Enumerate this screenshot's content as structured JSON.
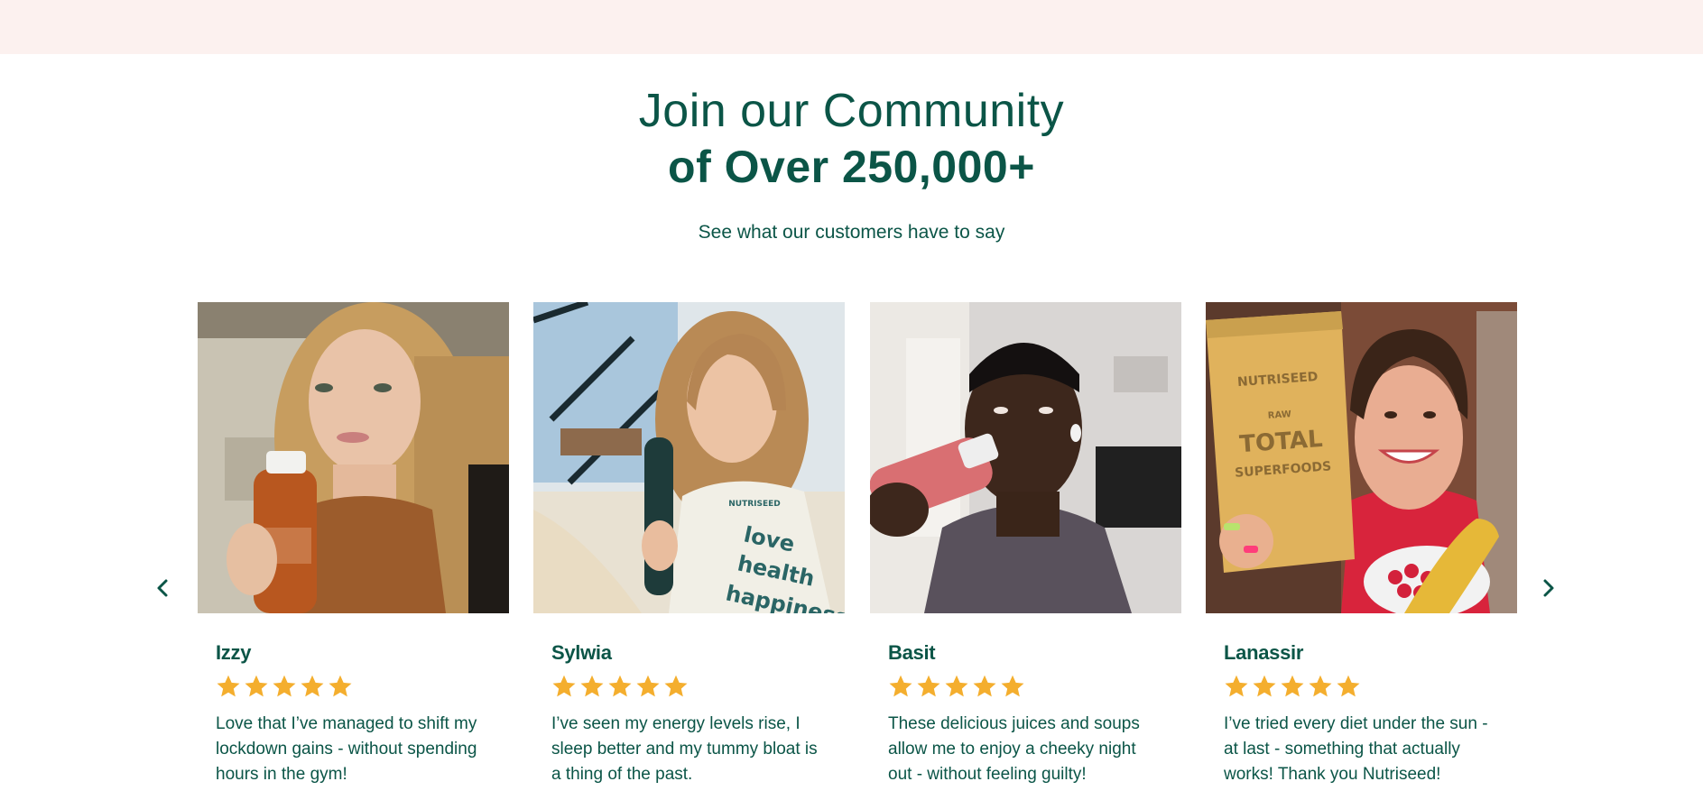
{
  "heading": {
    "line1": "Join our Community",
    "line2": "of Over 250,000+"
  },
  "subtitle": "See what our customers have to say",
  "carousel": {
    "prev_icon": "chevron-left-icon",
    "next_icon": "chevron-right-icon"
  },
  "colors": {
    "brand_green": "#0b5547",
    "star_gold": "#f4ae2e",
    "top_band": "#fcf1ef"
  },
  "reviews": [
    {
      "name": "Izzy",
      "rating": 5,
      "text": "Love that I’ve managed to shift my lockdown gains - without spending hours in the gym!"
    },
    {
      "name": "Sylwia",
      "rating": 5,
      "text": "I’ve seen my energy levels rise, I sleep better and my tummy bloat is a thing of the past.",
      "shirt_text": [
        "NUTRISEED",
        "love",
        "health",
        "happiness"
      ]
    },
    {
      "name": "Basit",
      "rating": 5,
      "text": "These delicious juices and soups allow me to enjoy a cheeky night out - without feeling guilty!"
    },
    {
      "name": "Lanassir",
      "rating": 5,
      "text": "I’ve tried every diet under the sun - at last - something that actually works! Thank you Nutriseed!",
      "pack_text": [
        "NUTRISEED",
        "RAW",
        "TOTAL",
        "SUPERFOODS"
      ]
    }
  ]
}
